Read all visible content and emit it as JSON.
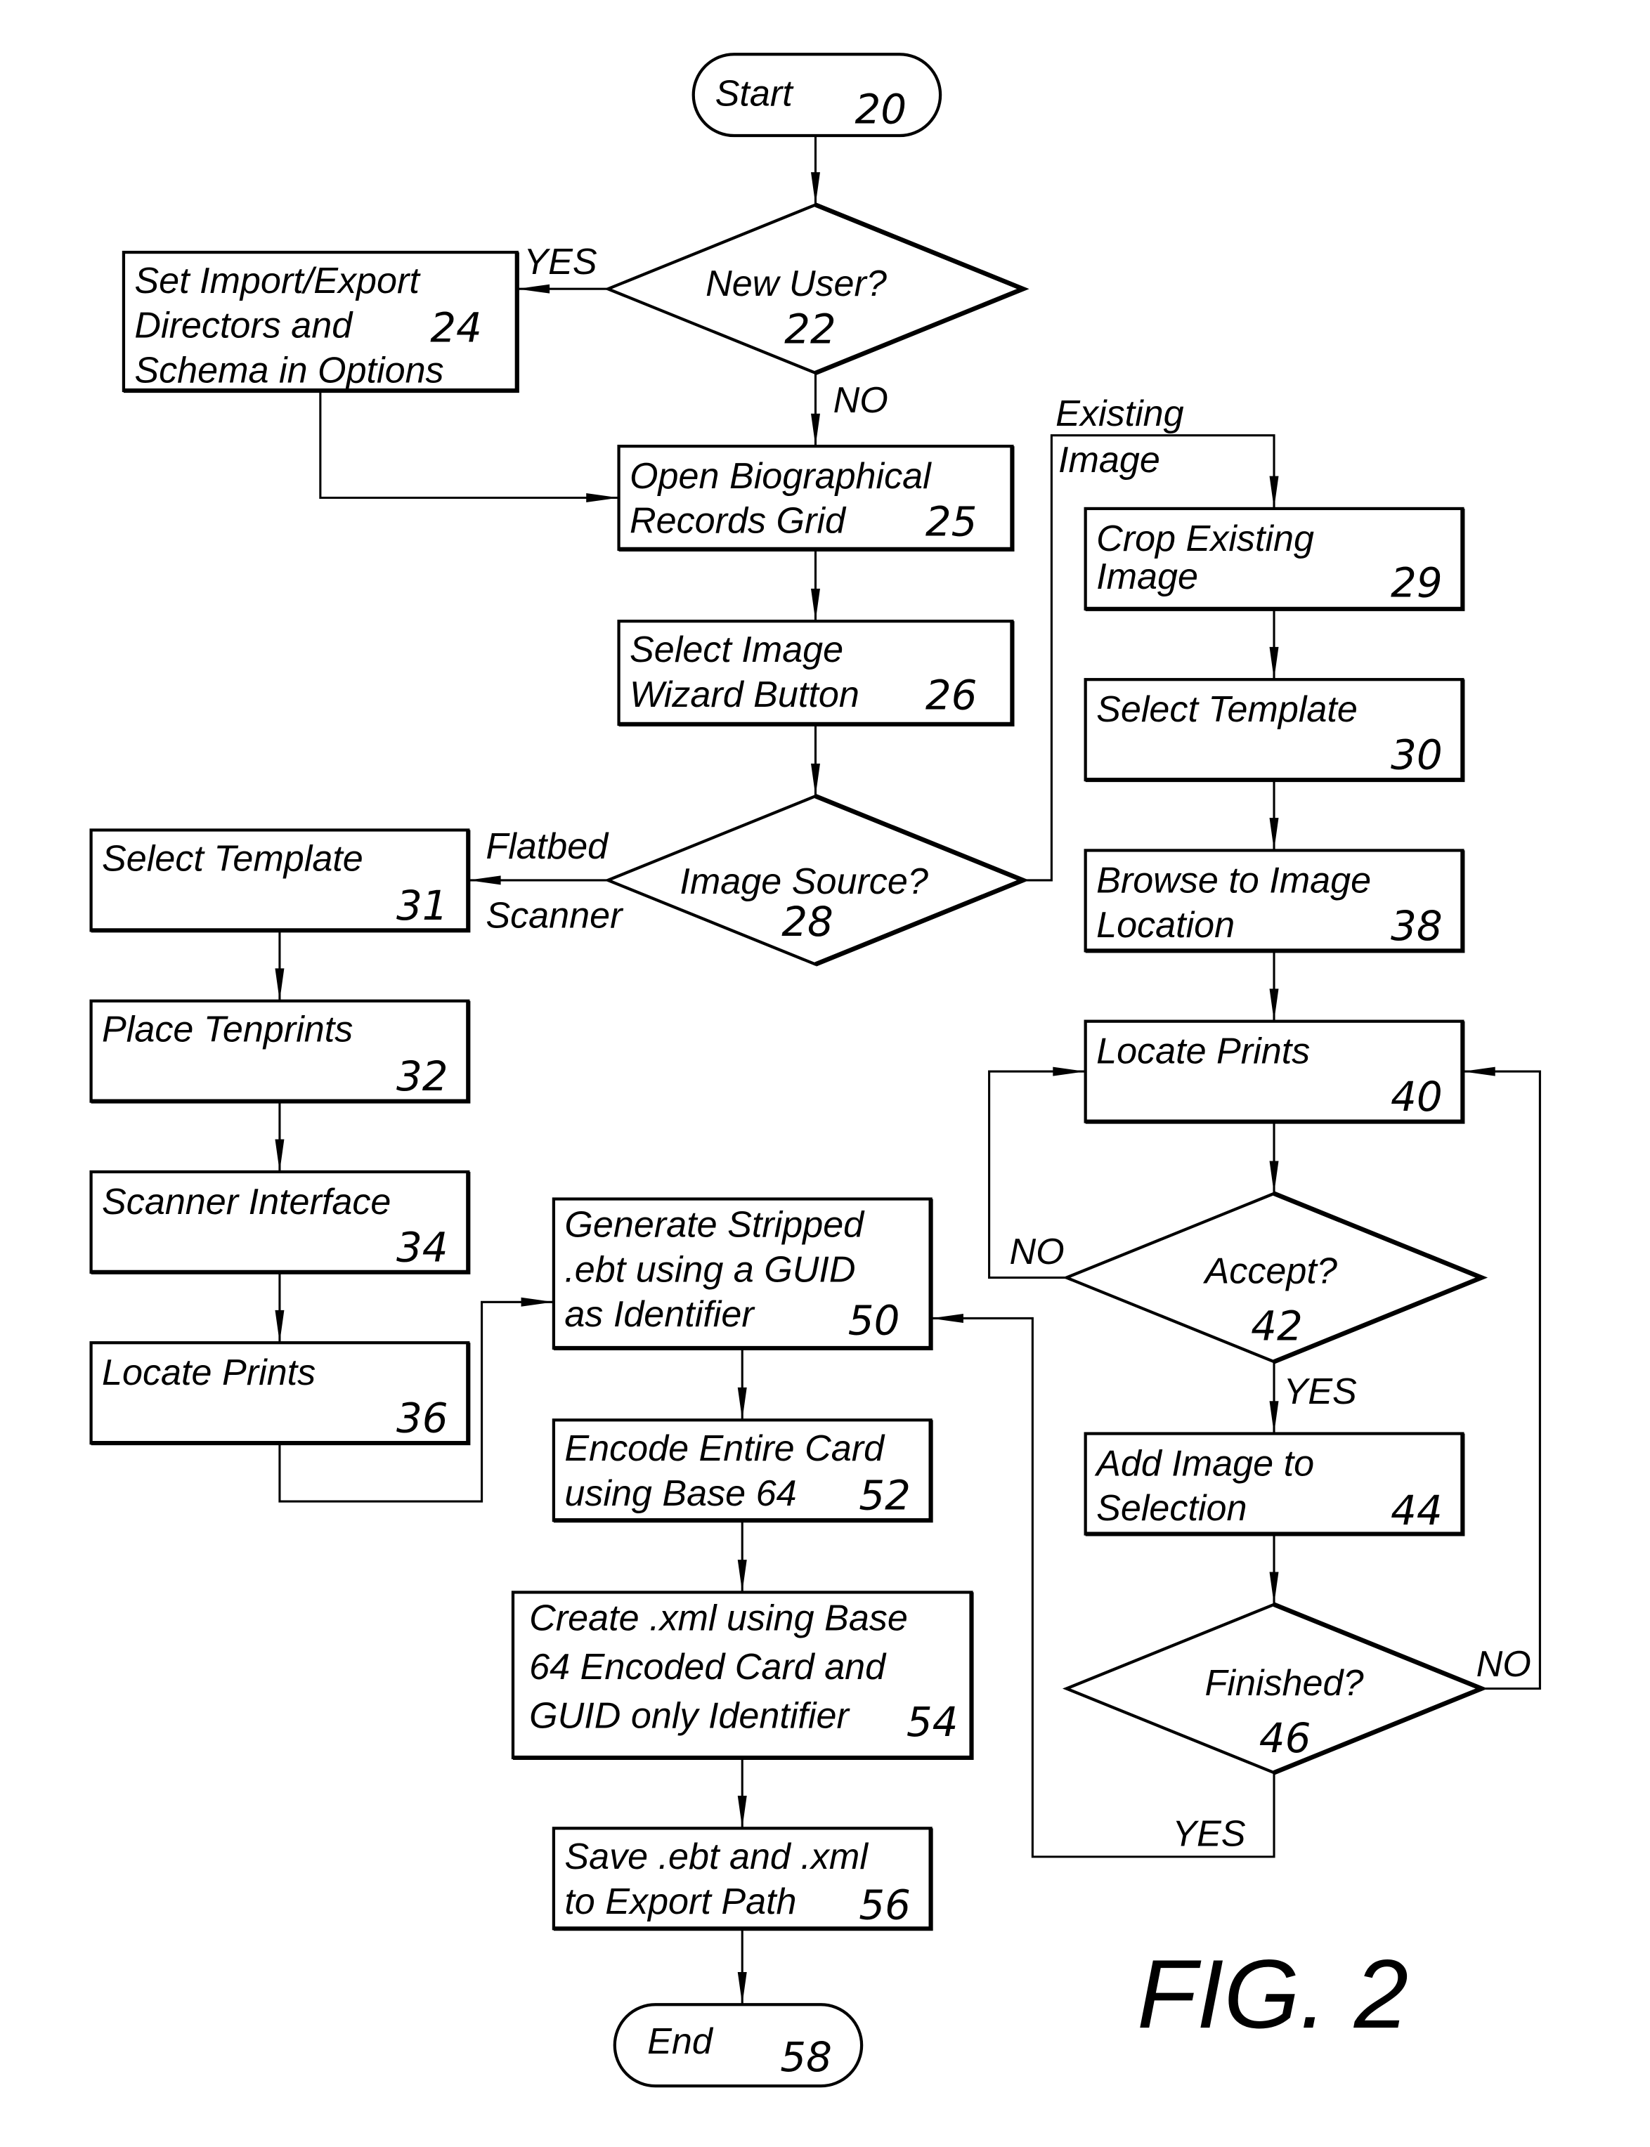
{
  "figure_label": "FIG. 2",
  "nodes": {
    "start": {
      "lines": [
        "Start"
      ],
      "ref": "20"
    },
    "n22": {
      "lines": [
        "New User?"
      ],
      "ref": "22"
    },
    "n24": {
      "lines": [
        "Set Import/Export",
        "Directors and",
        "Schema in Options"
      ],
      "ref": "24"
    },
    "n25": {
      "lines": [
        "Open Biographical",
        "Records Grid"
      ],
      "ref": "25"
    },
    "n26": {
      "lines": [
        "Select Image",
        "Wizard Button"
      ],
      "ref": "26"
    },
    "n28": {
      "lines": [
        "Image Source?"
      ],
      "ref": "28"
    },
    "n29": {
      "lines": [
        "Crop Existing",
        "Image"
      ],
      "ref": "29"
    },
    "n30": {
      "lines": [
        "Select Template"
      ],
      "ref": "30"
    },
    "n31": {
      "lines": [
        "Select Template"
      ],
      "ref": "31"
    },
    "n32": {
      "lines": [
        "Place Tenprints"
      ],
      "ref": "32"
    },
    "n34": {
      "lines": [
        "Scanner Interface"
      ],
      "ref": "34"
    },
    "n36": {
      "lines": [
        "Locate Prints"
      ],
      "ref": "36"
    },
    "n38": {
      "lines": [
        "Browse to Image",
        "Location"
      ],
      "ref": "38"
    },
    "n40": {
      "lines": [
        "Locate Prints"
      ],
      "ref": "40"
    },
    "n42": {
      "lines": [
        "Accept?"
      ],
      "ref": "42"
    },
    "n44": {
      "lines": [
        "Add Image to",
        "Selection"
      ],
      "ref": "44"
    },
    "n46": {
      "lines": [
        "Finished?"
      ],
      "ref": "46"
    },
    "n50": {
      "lines": [
        "Generate Stripped",
        ".ebt using a GUID",
        " as Identifier"
      ],
      "ref": "50"
    },
    "n52": {
      "lines": [
        "Encode Entire Card",
        "using Base 64"
      ],
      "ref": "52"
    },
    "n54": {
      "lines": [
        "Create .xml using Base",
        "64 Encoded Card and",
        "GUID only Identifier"
      ],
      "ref": "54"
    },
    "n56": {
      "lines": [
        "Save .ebt and .xml",
        "to Export Path"
      ],
      "ref": "56"
    },
    "end": {
      "lines": [
        "End"
      ],
      "ref": "58"
    }
  },
  "edge_labels": {
    "yes_22": "YES",
    "no_22": "NO",
    "existing_image_1": "Existing",
    "existing_image_2": "Image",
    "flatbed": "Flatbed",
    "scanner": "Scanner",
    "no_42": "NO",
    "yes_42": "YES",
    "no_46": "NO",
    "yes_46": "YES"
  },
  "edges": [
    {
      "from": "start",
      "to": "n22"
    },
    {
      "from": "n22",
      "to": "n24",
      "label": "yes_22"
    },
    {
      "from": "n22",
      "to": "n25",
      "label": "no_22"
    },
    {
      "from": "n24",
      "to": "n25"
    },
    {
      "from": "n25",
      "to": "n26"
    },
    {
      "from": "n26",
      "to": "n28"
    },
    {
      "from": "n28",
      "to": "n31",
      "label": "flatbed"
    },
    {
      "from": "n28",
      "to": "n29",
      "label": "existing_image_1"
    },
    {
      "from": "n31",
      "to": "n32"
    },
    {
      "from": "n32",
      "to": "n34"
    },
    {
      "from": "n34",
      "to": "n36"
    },
    {
      "from": "n36",
      "to": "n50"
    },
    {
      "from": "n29",
      "to": "n30"
    },
    {
      "from": "n30",
      "to": "n38"
    },
    {
      "from": "n38",
      "to": "n40"
    },
    {
      "from": "n40",
      "to": "n42"
    },
    {
      "from": "n42",
      "to": "n40",
      "label": "no_42"
    },
    {
      "from": "n42",
      "to": "n44",
      "label": "yes_42"
    },
    {
      "from": "n44",
      "to": "n46"
    },
    {
      "from": "n46",
      "to": "n40",
      "label": "no_46"
    },
    {
      "from": "n46",
      "to": "n50",
      "label": "yes_46"
    },
    {
      "from": "n50",
      "to": "n52"
    },
    {
      "from": "n52",
      "to": "n54"
    },
    {
      "from": "n54",
      "to": "n56"
    },
    {
      "from": "n56",
      "to": "end"
    }
  ]
}
